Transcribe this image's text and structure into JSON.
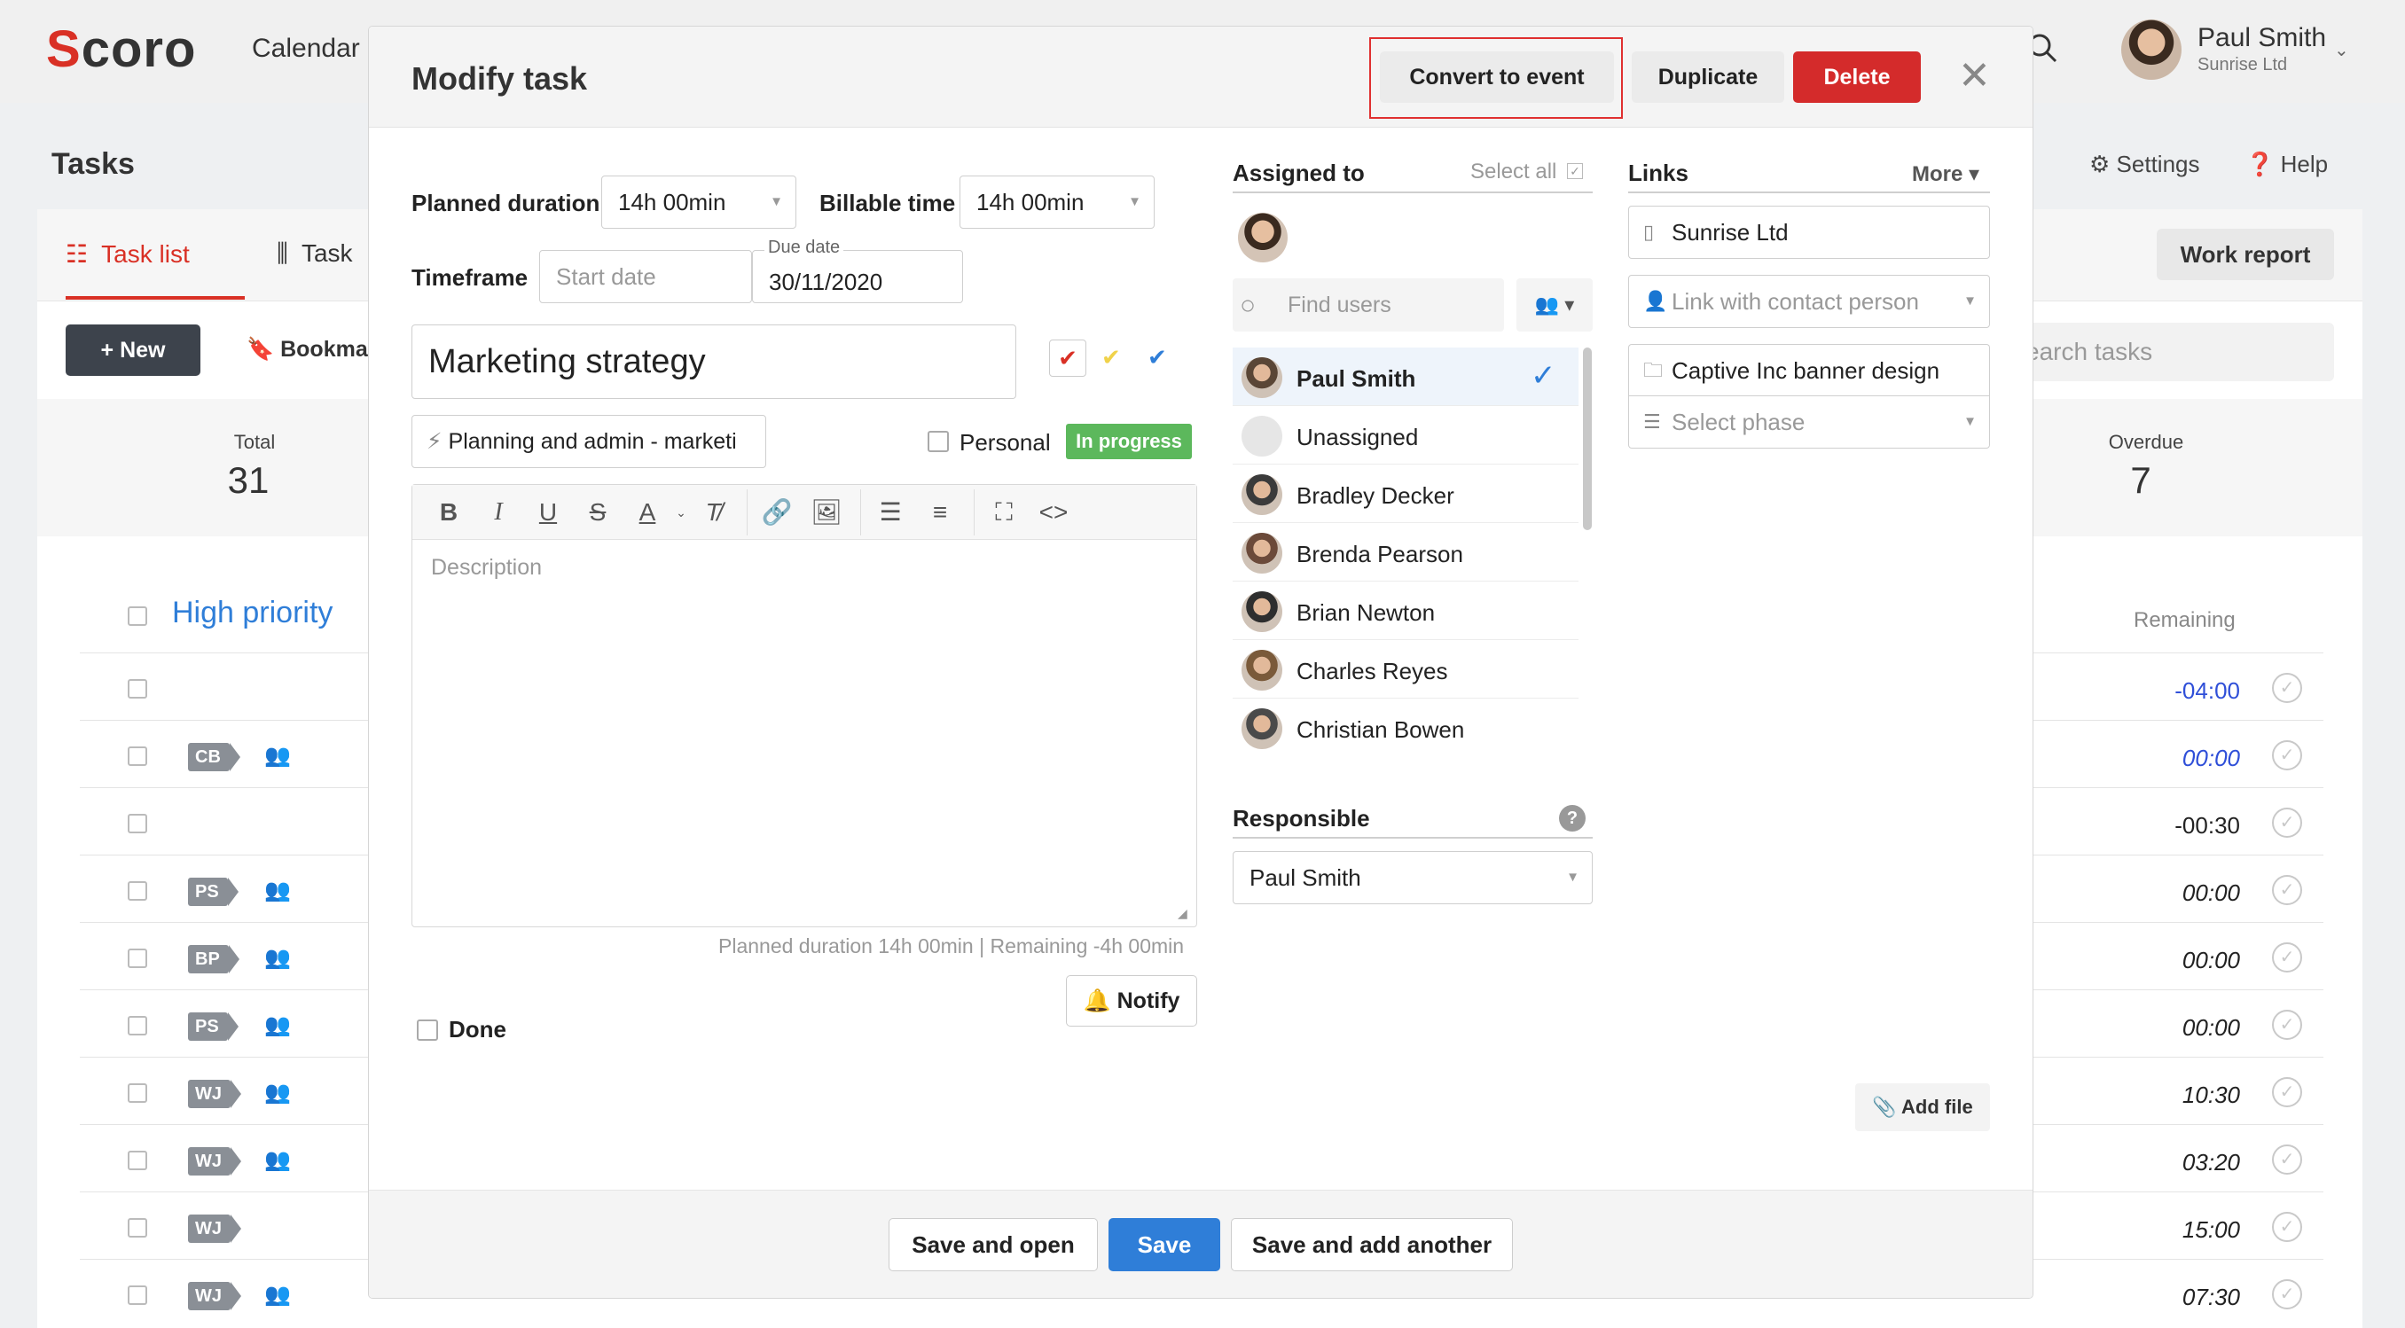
{
  "app": {
    "logo": "Scoro",
    "nav_calendar": "Calendar",
    "user_name": "Paul Smith",
    "user_company": "Sunrise Ltd",
    "page_title": "Tasks",
    "settings": "Settings",
    "help": "Help"
  },
  "tabs": {
    "task_list": "Task list",
    "task": "Task",
    "work_report": "Work report"
  },
  "actions": {
    "new": "New",
    "bookmark": "Bookmar",
    "search_placeholder": "earch tasks"
  },
  "stats": {
    "total_label": "Total",
    "total_value": "31",
    "overdue_label": "Overdue",
    "overdue_value": "7"
  },
  "list": {
    "group_title": "High priority",
    "remaining_header": "Remaining",
    "rows": [
      {
        "tag": "",
        "people": false,
        "time": "-04:00"
      },
      {
        "tag": "CB",
        "people": true,
        "time": "00:00"
      },
      {
        "tag": "",
        "people": false,
        "time": "-00:30"
      },
      {
        "tag": "PS",
        "people": true,
        "time": "00:00"
      },
      {
        "tag": "BP",
        "people": true,
        "time": "00:00"
      },
      {
        "tag": "PS",
        "people": true,
        "time": "00:00"
      },
      {
        "tag": "WJ",
        "people": true,
        "time": "10:30"
      },
      {
        "tag": "WJ",
        "people": true,
        "time": "03:20"
      },
      {
        "tag": "WJ",
        "people": false,
        "time": "15:00"
      },
      {
        "tag": "WJ",
        "people": true,
        "time": "07:30"
      }
    ]
  },
  "modal": {
    "title": "Modify task",
    "convert_label": "Convert to event",
    "duplicate_label": "Duplicate",
    "delete_label": "Delete",
    "planned_duration_label": "Planned duration",
    "planned_duration_value": "14h 00min",
    "billable_time_label": "Billable time",
    "billable_time_value": "14h 00min",
    "timeframe_label": "Timeframe",
    "start_date_placeholder": "Start date",
    "due_date_label": "Due date",
    "due_date_value": "30/11/2020",
    "task_name": "Marketing strategy",
    "activity": "Planning and admin - marketi",
    "personal_label": "Personal",
    "status": "In progress",
    "description_placeholder": "Description",
    "planned_info": "Planned duration 14h 00min | Remaining -4h 00min",
    "notify_label": "Notify",
    "done_label": "Done",
    "assigned_label": "Assigned to",
    "select_all": "Select all",
    "find_users_placeholder": "Find users",
    "users": [
      {
        "name": "Paul Smith",
        "selected": true,
        "color": "#5a4636"
      },
      {
        "name": "Unassigned",
        "selected": false,
        "color": "#dddddd"
      },
      {
        "name": "Bradley Decker",
        "selected": false,
        "color": "#3b3b3b"
      },
      {
        "name": "Brenda Pearson",
        "selected": false,
        "color": "#6b4a3a"
      },
      {
        "name": "Brian Newton",
        "selected": false,
        "color": "#2e2e2e"
      },
      {
        "name": "Charles Reyes",
        "selected": false,
        "color": "#7a5a3a"
      },
      {
        "name": "Christian Bowen",
        "selected": false,
        "color": "#4a4a4a"
      }
    ],
    "responsible_label": "Responsible",
    "responsible_value": "Paul Smith",
    "links_label": "Links",
    "more_label": "More",
    "company_link": "Sunrise Ltd",
    "contact_placeholder": "Link with contact person",
    "project_link": "Captive Inc banner design",
    "phase_placeholder": "Select phase",
    "add_file_label": "Add file",
    "save_open_label": "Save and open",
    "save_label": "Save",
    "save_add_label": "Save and add another"
  },
  "colors": {
    "accent_red": "#d93025",
    "primary_blue": "#2f7ed8",
    "status_green": "#5cb85c",
    "delete_red": "#d42b2b"
  }
}
